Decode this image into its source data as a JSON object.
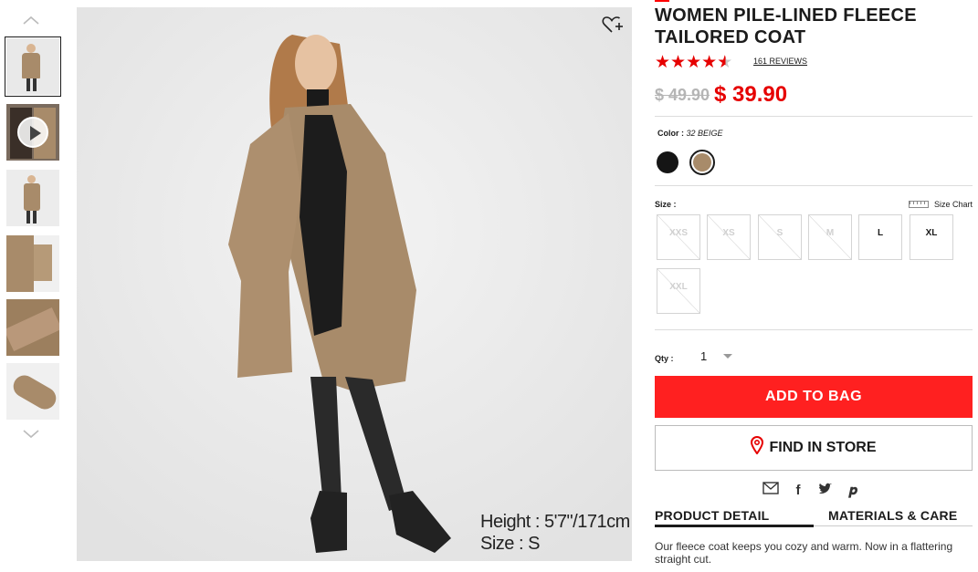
{
  "product": {
    "title": "WOMEN PILE-LINED FLEECE TAILORED COAT",
    "rating": 4.5,
    "reviews": "161 REVIEWS",
    "old_price": "$ 49.90",
    "price": "$ 39.90"
  },
  "image": {
    "caption_height": "Height : 5'7\"/171cm",
    "caption_size": "Size : S"
  },
  "color": {
    "label": "Color :",
    "selected": "32 BEIGE",
    "swatches": [
      {
        "name": "black",
        "hex": "#151515"
      },
      {
        "name": "beige",
        "hex": "#a88b6a",
        "selected": true
      }
    ]
  },
  "size": {
    "label": "Size :",
    "chart_label": "Size Chart",
    "options": [
      {
        "label": "XXS",
        "available": false
      },
      {
        "label": "XS",
        "available": false
      },
      {
        "label": "S",
        "available": false
      },
      {
        "label": "M",
        "available": false
      },
      {
        "label": "L",
        "available": true
      },
      {
        "label": "XL",
        "available": true
      },
      {
        "label": "XXL",
        "available": false
      }
    ]
  },
  "qty": {
    "label": "Qty :",
    "value": "1"
  },
  "buttons": {
    "add_to_bag": "ADD TO BAG",
    "find_in_store": "FIND IN STORE"
  },
  "share_icons": [
    "mail-icon",
    "facebook-icon",
    "twitter-icon",
    "pinterest-icon"
  ],
  "tabs": {
    "detail": "PRODUCT DETAIL",
    "materials": "MATERIALS & CARE"
  },
  "description": "Our fleece coat keeps you cozy and warm. Now in a flattering straight cut.",
  "colors": {
    "accent": "#ff2020",
    "sale": "#e60000"
  }
}
